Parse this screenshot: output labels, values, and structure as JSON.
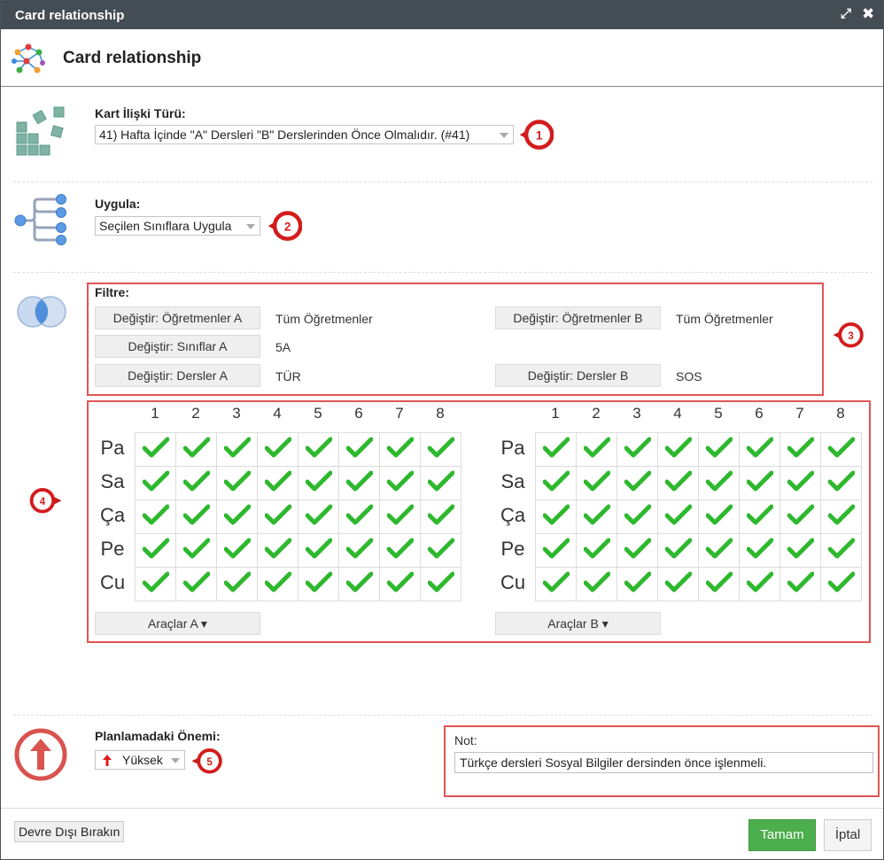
{
  "titlebar": {
    "title": "Card relationship",
    "maximize_icon": "maximize-icon",
    "close_icon": "close-icon"
  },
  "header": {
    "title": "Card relationship",
    "icon": "network-graph-icon"
  },
  "relation_type": {
    "label": "Kart İlişki Türü:",
    "value": "41) Hafta İçinde \"A\" Dersleri \"B\" Derslerinden Önce Olmalıdır. (#41)",
    "icon": "cards-icon"
  },
  "apply": {
    "label": "Uygula:",
    "value": "Seçilen Sınıflara Uygula",
    "icon": "tree-branch-icon"
  },
  "filter": {
    "label": "Filtre:",
    "icon": "venn-icon",
    "rows": [
      {
        "btn_a": "Değiştir: Öğretmenler A",
        "val_a": "Tüm Öğretmenler",
        "btn_b": "Değiştir: Öğretmenler B",
        "val_b": "Tüm Öğretmenler"
      },
      {
        "btn_a": "Değiştir: Sınıflar A",
        "val_a": "5A",
        "btn_b": "",
        "val_b": ""
      },
      {
        "btn_a": "Değiştir: Dersler A",
        "val_a": "TÜR",
        "btn_b": "Değiştir: Dersler B",
        "val_b": "SOS"
      }
    ]
  },
  "grid": {
    "columns": [
      "1",
      "2",
      "3",
      "4",
      "5",
      "6",
      "7",
      "8"
    ],
    "rows": [
      "Pa",
      "Sa",
      "Ça",
      "Pe",
      "Cu"
    ],
    "tools_a": "Araçlar A ▾",
    "tools_b": "Araçlar B ▾",
    "check_color": "#2eb82e"
  },
  "priority": {
    "label": "Planlamadaki Önemi:",
    "value": "Yüksek",
    "icon": "arrow-up-circle-icon"
  },
  "note": {
    "label": "Not:",
    "value": "Türkçe dersleri Sosyal Bilgiler dersinden önce işlenmeli."
  },
  "badges": [
    "1",
    "2",
    "3",
    "4",
    "5"
  ],
  "footer": {
    "disable": "Devre Dışı Bırakın",
    "ok": "Tamam",
    "cancel": "İptal"
  },
  "colors": {
    "titlebar": "#444c54",
    "accent_red": "#e01b1b",
    "ok_green": "#4cae4c"
  }
}
